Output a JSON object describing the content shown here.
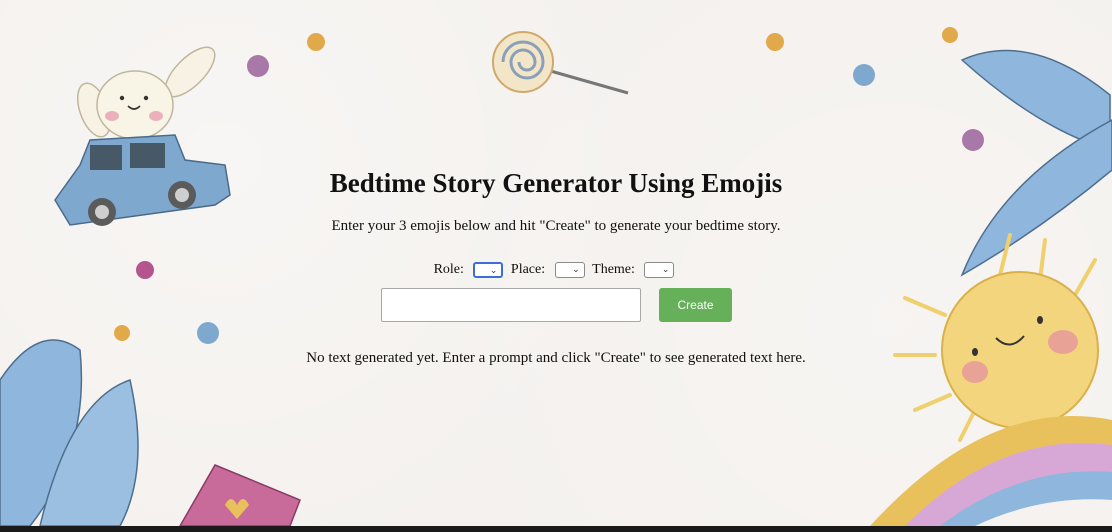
{
  "header": {
    "title": "Bedtime Story Generator Using Emojis",
    "instructions": "Enter your 3 emojis below and hit \"Create\" to generate your bedtime story."
  },
  "selectors": [
    {
      "label": "Role:",
      "selected": "",
      "focused": true
    },
    {
      "label": "Place:",
      "selected": ""
    },
    {
      "label": "Theme:",
      "selected": ""
    }
  ],
  "prompt": {
    "value": "",
    "placeholder": ""
  },
  "create_button": {
    "label": "Create",
    "color": "#66b05a"
  },
  "output": {
    "text": "No text generated yet. Enter a prompt and click \"Create\" to see generated text here."
  },
  "decor": {
    "icons": [
      "bunny-icon",
      "car-icon",
      "lollipop-icon",
      "leaf-icon",
      "sun-icon",
      "rainbow-icon",
      "candy-dot-icon",
      "gift-box-icon"
    ]
  }
}
